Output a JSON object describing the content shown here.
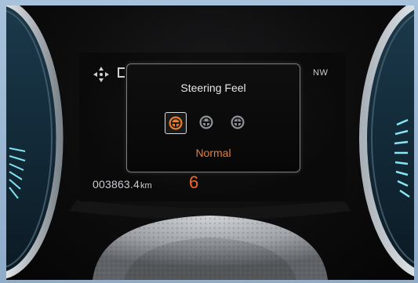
{
  "display": {
    "heading": "NW",
    "odometer_value": "003863.4",
    "odometer_unit": "km",
    "gear": "6"
  },
  "popup": {
    "title": "Steering Feel",
    "selected_value": "Normal",
    "modes": [
      {
        "icon": "steering-wheel-icon",
        "selected": true
      },
      {
        "icon": "steering-wheel-icon",
        "selected": false
      },
      {
        "icon": "steering-wheel-icon",
        "selected": false
      }
    ]
  },
  "colors": {
    "accent": "#ee7d2a",
    "gear": "#ef6a2b",
    "text": "#e6e8eb",
    "frame": "#9cb6d2"
  }
}
